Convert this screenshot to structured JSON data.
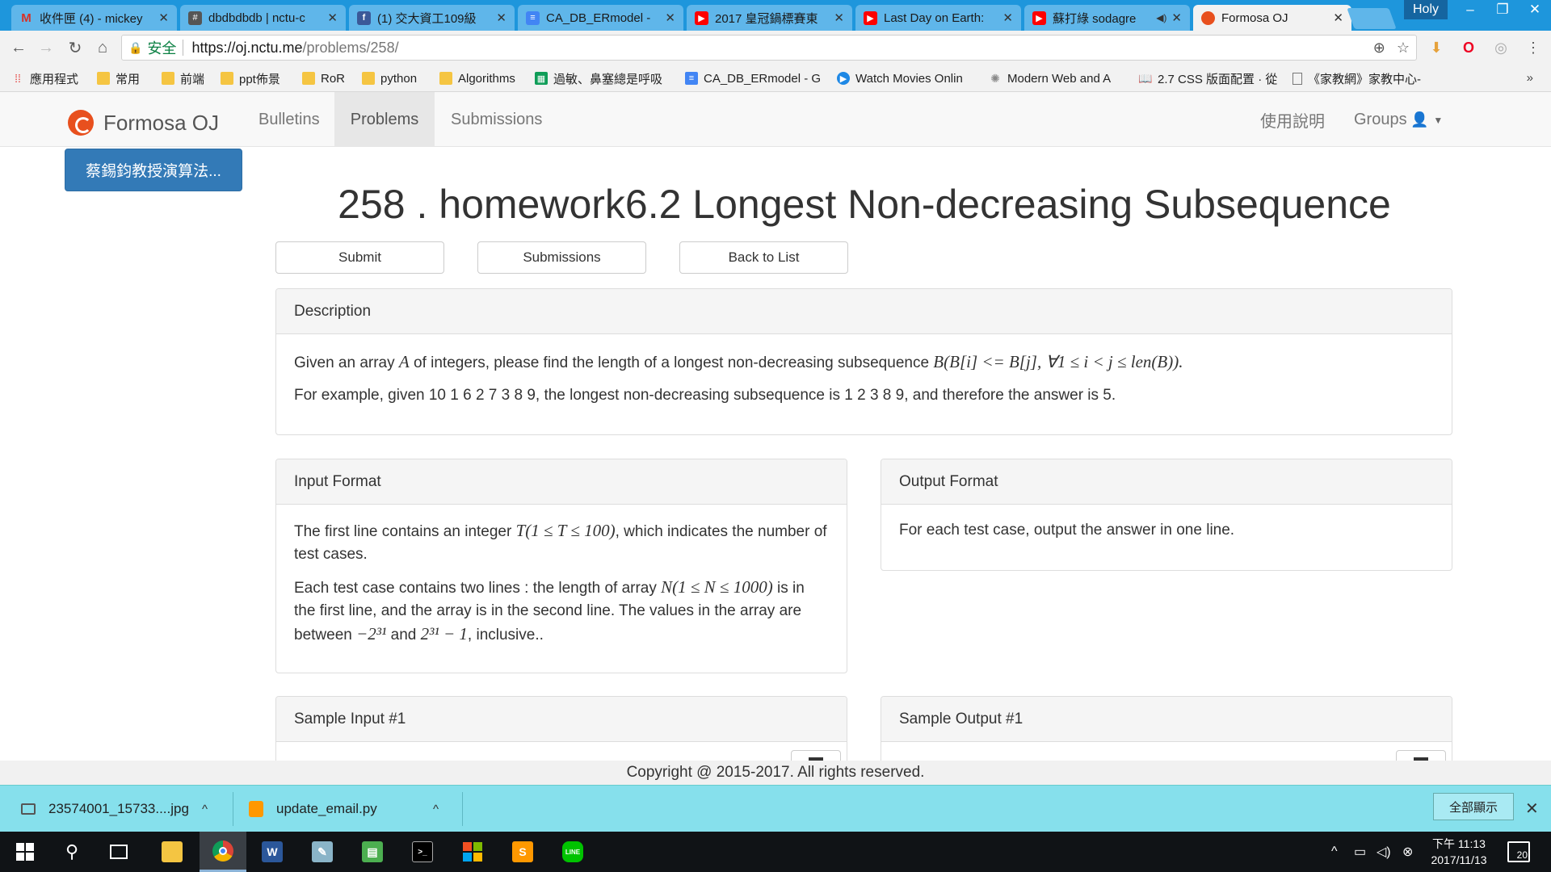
{
  "browser": {
    "tabs": [
      {
        "title": "收件匣 (4) - mickey",
        "icon": "gmail-icon",
        "color": "#d93025"
      },
      {
        "title": "dbdbdbdb | nctu-c",
        "icon": "slack-icon",
        "color": "#555555"
      },
      {
        "title": "(1) 交大資工109級",
        "icon": "facebook-icon",
        "color": "#3b5998"
      },
      {
        "title": "CA_DB_ERmodel -",
        "icon": "docs-icon",
        "color": "#4285f4"
      },
      {
        "title": "2017 皇冠鍋標賽東",
        "icon": "youtube-icon",
        "color": "#ff0000"
      },
      {
        "title": "Last Day on Earth:",
        "icon": "youtube-icon",
        "color": "#ff0000"
      },
      {
        "title": "蘇打綠 sodagre",
        "icon": "youtube-icon",
        "color": "#ff0000"
      },
      {
        "title": "Formosa OJ",
        "icon": "formosa-icon",
        "color": "#e8501e"
      }
    ],
    "profile_name": "Holy",
    "security_label": "安全",
    "url_host": "https://oj.nctu.me",
    "url_path": "/problems/258/",
    "bookmarks": [
      {
        "label": "應用程式",
        "icon": "apps-icon"
      },
      {
        "label": "常用",
        "icon": "folder-icon"
      },
      {
        "label": "前端",
        "icon": "folder-icon"
      },
      {
        "label": "ppt佈景",
        "icon": "folder-icon"
      },
      {
        "label": "RoR",
        "icon": "folder-icon"
      },
      {
        "label": "python",
        "icon": "folder-icon"
      },
      {
        "label": "Algorithms",
        "icon": "folder-icon"
      },
      {
        "label": "過敏、鼻塞總是呼吸",
        "icon": "sheet-icon"
      },
      {
        "label": "CA_DB_ERmodel - G",
        "icon": "docs-icon"
      },
      {
        "label": "Watch Movies Onlin",
        "icon": "play-icon"
      },
      {
        "label": "Modern Web and A",
        "icon": "globe-icon"
      },
      {
        "label": "2.7 CSS 版面配置 · 從",
        "icon": "book-icon"
      },
      {
        "label": "《家教網》家教中心-",
        "icon": "page-icon"
      }
    ]
  },
  "site": {
    "brand": "Formosa OJ",
    "nav": [
      "Bulletins",
      "Problems",
      "Submissions"
    ],
    "nav_right": [
      "使用說明",
      "Groups"
    ],
    "sidebar_button": "蔡錫鈞教授演算法...",
    "problem_title": "258 . homework6.2 Longest Non-decreasing Subsequence",
    "buttons": [
      "Submit",
      "Submissions",
      "Back to List"
    ],
    "description": {
      "heading": "Description",
      "p1_before": "Given an array ",
      "p1_var": "A",
      "p1_mid": " of integers, please find the length of a longest non-decreasing subsequence ",
      "p1_math": "B(B[i] <= B[j], ∀1 ≤ i < j ≤ len(B)).",
      "p2": "For example, given 10 1 6 2 7 3 8 9, the longest non-decreasing subsequence is 1 2 3 8 9, and therefore the answer is 5."
    },
    "input_format": {
      "heading": "Input Format",
      "p1_before": "The first line contains an integer ",
      "p1_math": "T(1 ≤ T ≤ 100)",
      "p1_after": ", which indicates the number of test cases.",
      "p2_before": "Each test case contains two lines : the length of array ",
      "p2_math": "N(1 ≤ N ≤ 1000)",
      "p2_mid": " is in the first line, and the array is in the second line. The values in the array are between ",
      "p2_math_low": "−2³¹",
      "p2_and": " and ",
      "p2_math_high": "2³¹ − 1",
      "p2_after": ", inclusive.."
    },
    "output_format": {
      "heading": "Output Format",
      "text": "For each test case, output the answer in one line."
    },
    "sample_input_heading": "Sample Input #1",
    "sample_output_heading": "Sample Output #1",
    "footer": "Copyright @ 2015-2017. All rights reserved."
  },
  "downloads": {
    "items": [
      "23574001_15733....jpg",
      "update_email.py"
    ],
    "show_all": "全部顯示"
  },
  "taskbar": {
    "time": "下午 11:13",
    "date": "2017/11/13",
    "notifications": "20"
  }
}
